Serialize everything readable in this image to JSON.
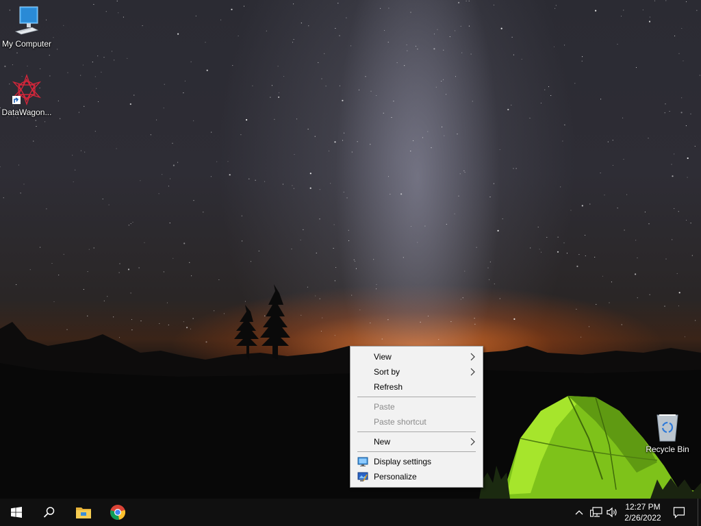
{
  "desktop": {
    "icons": [
      {
        "label": "My Computer",
        "icon": "computer-icon"
      },
      {
        "label": "DataWagon...",
        "icon": "datawagon-icon"
      },
      {
        "label": "Recycle Bin",
        "icon": "recycle-bin-icon"
      }
    ]
  },
  "context_menu": {
    "items": [
      {
        "label": "View",
        "submenu": true,
        "enabled": true
      },
      {
        "label": "Sort by",
        "submenu": true,
        "enabled": true
      },
      {
        "label": "Refresh",
        "submenu": false,
        "enabled": true
      },
      {
        "label": "Paste",
        "submenu": false,
        "enabled": false
      },
      {
        "label": "Paste shortcut",
        "submenu": false,
        "enabled": false
      },
      {
        "label": "New",
        "submenu": true,
        "enabled": true
      },
      {
        "label": "Display settings",
        "submenu": false,
        "enabled": true,
        "icon": "display-settings-icon"
      },
      {
        "label": "Personalize",
        "submenu": false,
        "enabled": true,
        "icon": "personalize-icon"
      }
    ]
  },
  "taskbar": {
    "buttons": [
      "start-icon",
      "search-icon",
      "file-explorer-icon",
      "chrome-icon"
    ],
    "tray": [
      "chevron-up-icon",
      "network-icon",
      "volume-icon"
    ],
    "clock": {
      "time": "12:27 PM",
      "date": "2/26/2022"
    },
    "notifications_icon": "action-center-icon"
  },
  "colors": {
    "taskbar": "#101010",
    "menu_bg": "#f2f2f2",
    "tent_green": "#8fd21c",
    "glow_orange": "#ff7a1e"
  }
}
